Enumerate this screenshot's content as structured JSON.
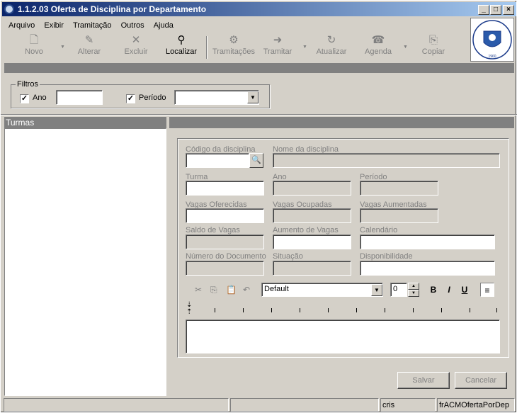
{
  "window": {
    "title": "1.1.2.03 Oferta de Disciplina por Departamento"
  },
  "title_buttons": {
    "minimize": "_",
    "maximize": "□",
    "close": "×"
  },
  "menu": [
    "Arquivo",
    "Exibir",
    "Tramitação",
    "Outros",
    "Ajuda"
  ],
  "toolbar": {
    "novo": "Novo",
    "alterar": "Alterar",
    "excluir": "Excluir",
    "localizar": "Localizar",
    "tramitacoes": "Tramitações",
    "tramitar": "Tramitar",
    "atualizar": "Atualizar",
    "agenda": "Agenda",
    "copiar": "Copiar"
  },
  "filters": {
    "legend": "Filtros",
    "ano_label": "Ano",
    "ano_checked": true,
    "ano_value": "",
    "periodo_label": "Período",
    "periodo_checked": true,
    "periodo_value": ""
  },
  "turmas": {
    "header": "Turmas"
  },
  "form": {
    "codigo_label": "Código da disciplina",
    "nome_label": "Nome da disciplina",
    "turma_label": "Turma",
    "ano_label": "Ano",
    "periodo_label": "Período",
    "vagas_oferecidas_label": "Vagas Oferecidas",
    "vagas_ocupadas_label": "Vagas Ocupadas",
    "vagas_aumentadas_label": "Vagas Aumentadas",
    "saldo_label": "Saldo de Vagas",
    "aumento_label": "Aumento de Vagas",
    "calendario_label": "Calendário",
    "numdoc_label": "Número do Documento",
    "situacao_label": "Situação",
    "disponibilidade_label": "Disponibilidade"
  },
  "editor": {
    "font": "Default",
    "size": "0",
    "bold": "B",
    "italic": "I",
    "underline": "U"
  },
  "buttons": {
    "salvar": "Salvar",
    "cancelar": "Cancelar"
  },
  "status": {
    "user": "cris",
    "form_name": "frACMOfertaPorDep"
  }
}
